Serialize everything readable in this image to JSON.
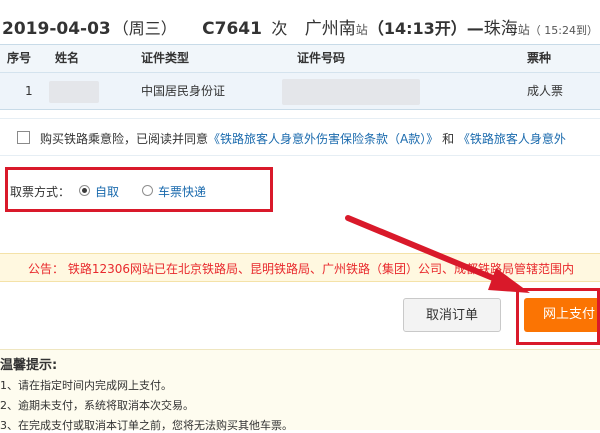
{
  "header": {
    "date": "2019-04-03",
    "weekday": "（周三）",
    "train_no": "C7641",
    "train_suffix": "次",
    "from_station": "广州南",
    "station_word": "站",
    "depart_time": "（14:13开）",
    "dash": "—",
    "to_station": "珠海",
    "arrive_time": "（ 15:24到）"
  },
  "table": {
    "headers": [
      "序号",
      "姓名",
      "证件类型",
      "证件号码",
      "票种"
    ],
    "rows": [
      {
        "no": "1",
        "name": "",
        "id_type": "中国居民身份证",
        "id_number": "",
        "ticket_type": "成人票"
      }
    ]
  },
  "insurance": {
    "text1": "购买铁路乘意险，已阅读并同意",
    "link1": "《铁路旅客人身意外伤害保险条款（A款）》",
    "text2": "和",
    "link2": "《铁路旅客人身意外"
  },
  "pickup": {
    "label": "取票方式：",
    "option_self": "自取",
    "option_express": "车票快递",
    "selected": "自取"
  },
  "notice": {
    "text": "公告： 铁路12306网站已在北京铁路局、昆明铁路局、广州铁路（集团）公司、成都铁路局管辖范围内"
  },
  "buttons": {
    "cancel": "取消订单",
    "pay": "网上支付"
  },
  "tips": {
    "title": "温馨提示:",
    "items": [
      "1、请在指定时间内完成网上支付。",
      "2、逾期未支付，系统将取消本次交易。",
      "3、在完成支付或取消本订单之前，您将无法购买其他车票。"
    ]
  },
  "colors": {
    "annotation_red": "#d9192a",
    "pay_orange": "#fb7403",
    "link_blue": "#1a6aad",
    "notice_red": "#e8292d"
  }
}
